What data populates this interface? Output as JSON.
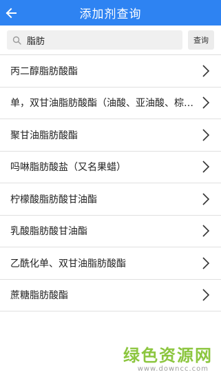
{
  "header": {
    "title": "添加剂查询",
    "back_icon": "arrow-left-icon"
  },
  "search": {
    "value": "脂肪",
    "icon": "search-icon",
    "button_label": "查询"
  },
  "results": [
    {
      "label": "丙二醇脂肪酸酯"
    },
    {
      "label": "单，双甘油脂肪酸酯（油酸、亚油酸、棕榈酸、山嵛酸、月桂酸、硬脂酸）"
    },
    {
      "label": "聚甘油脂肪酸酯"
    },
    {
      "label": "吗啉脂肪酸盐（又名果蜡）"
    },
    {
      "label": "柠檬酸脂肪酸甘油酯"
    },
    {
      "label": "乳酸脂肪酸甘油酯"
    },
    {
      "label": "乙酰化单、双甘油脂肪酸酯"
    },
    {
      "label": "蔗糖脂肪酸酯"
    }
  ],
  "watermark": {
    "main": "绿色资源网",
    "sub": "www.downcc.com"
  },
  "colors": {
    "header_bg": "#2e83f2",
    "watermark_green": "#8cc63f"
  }
}
